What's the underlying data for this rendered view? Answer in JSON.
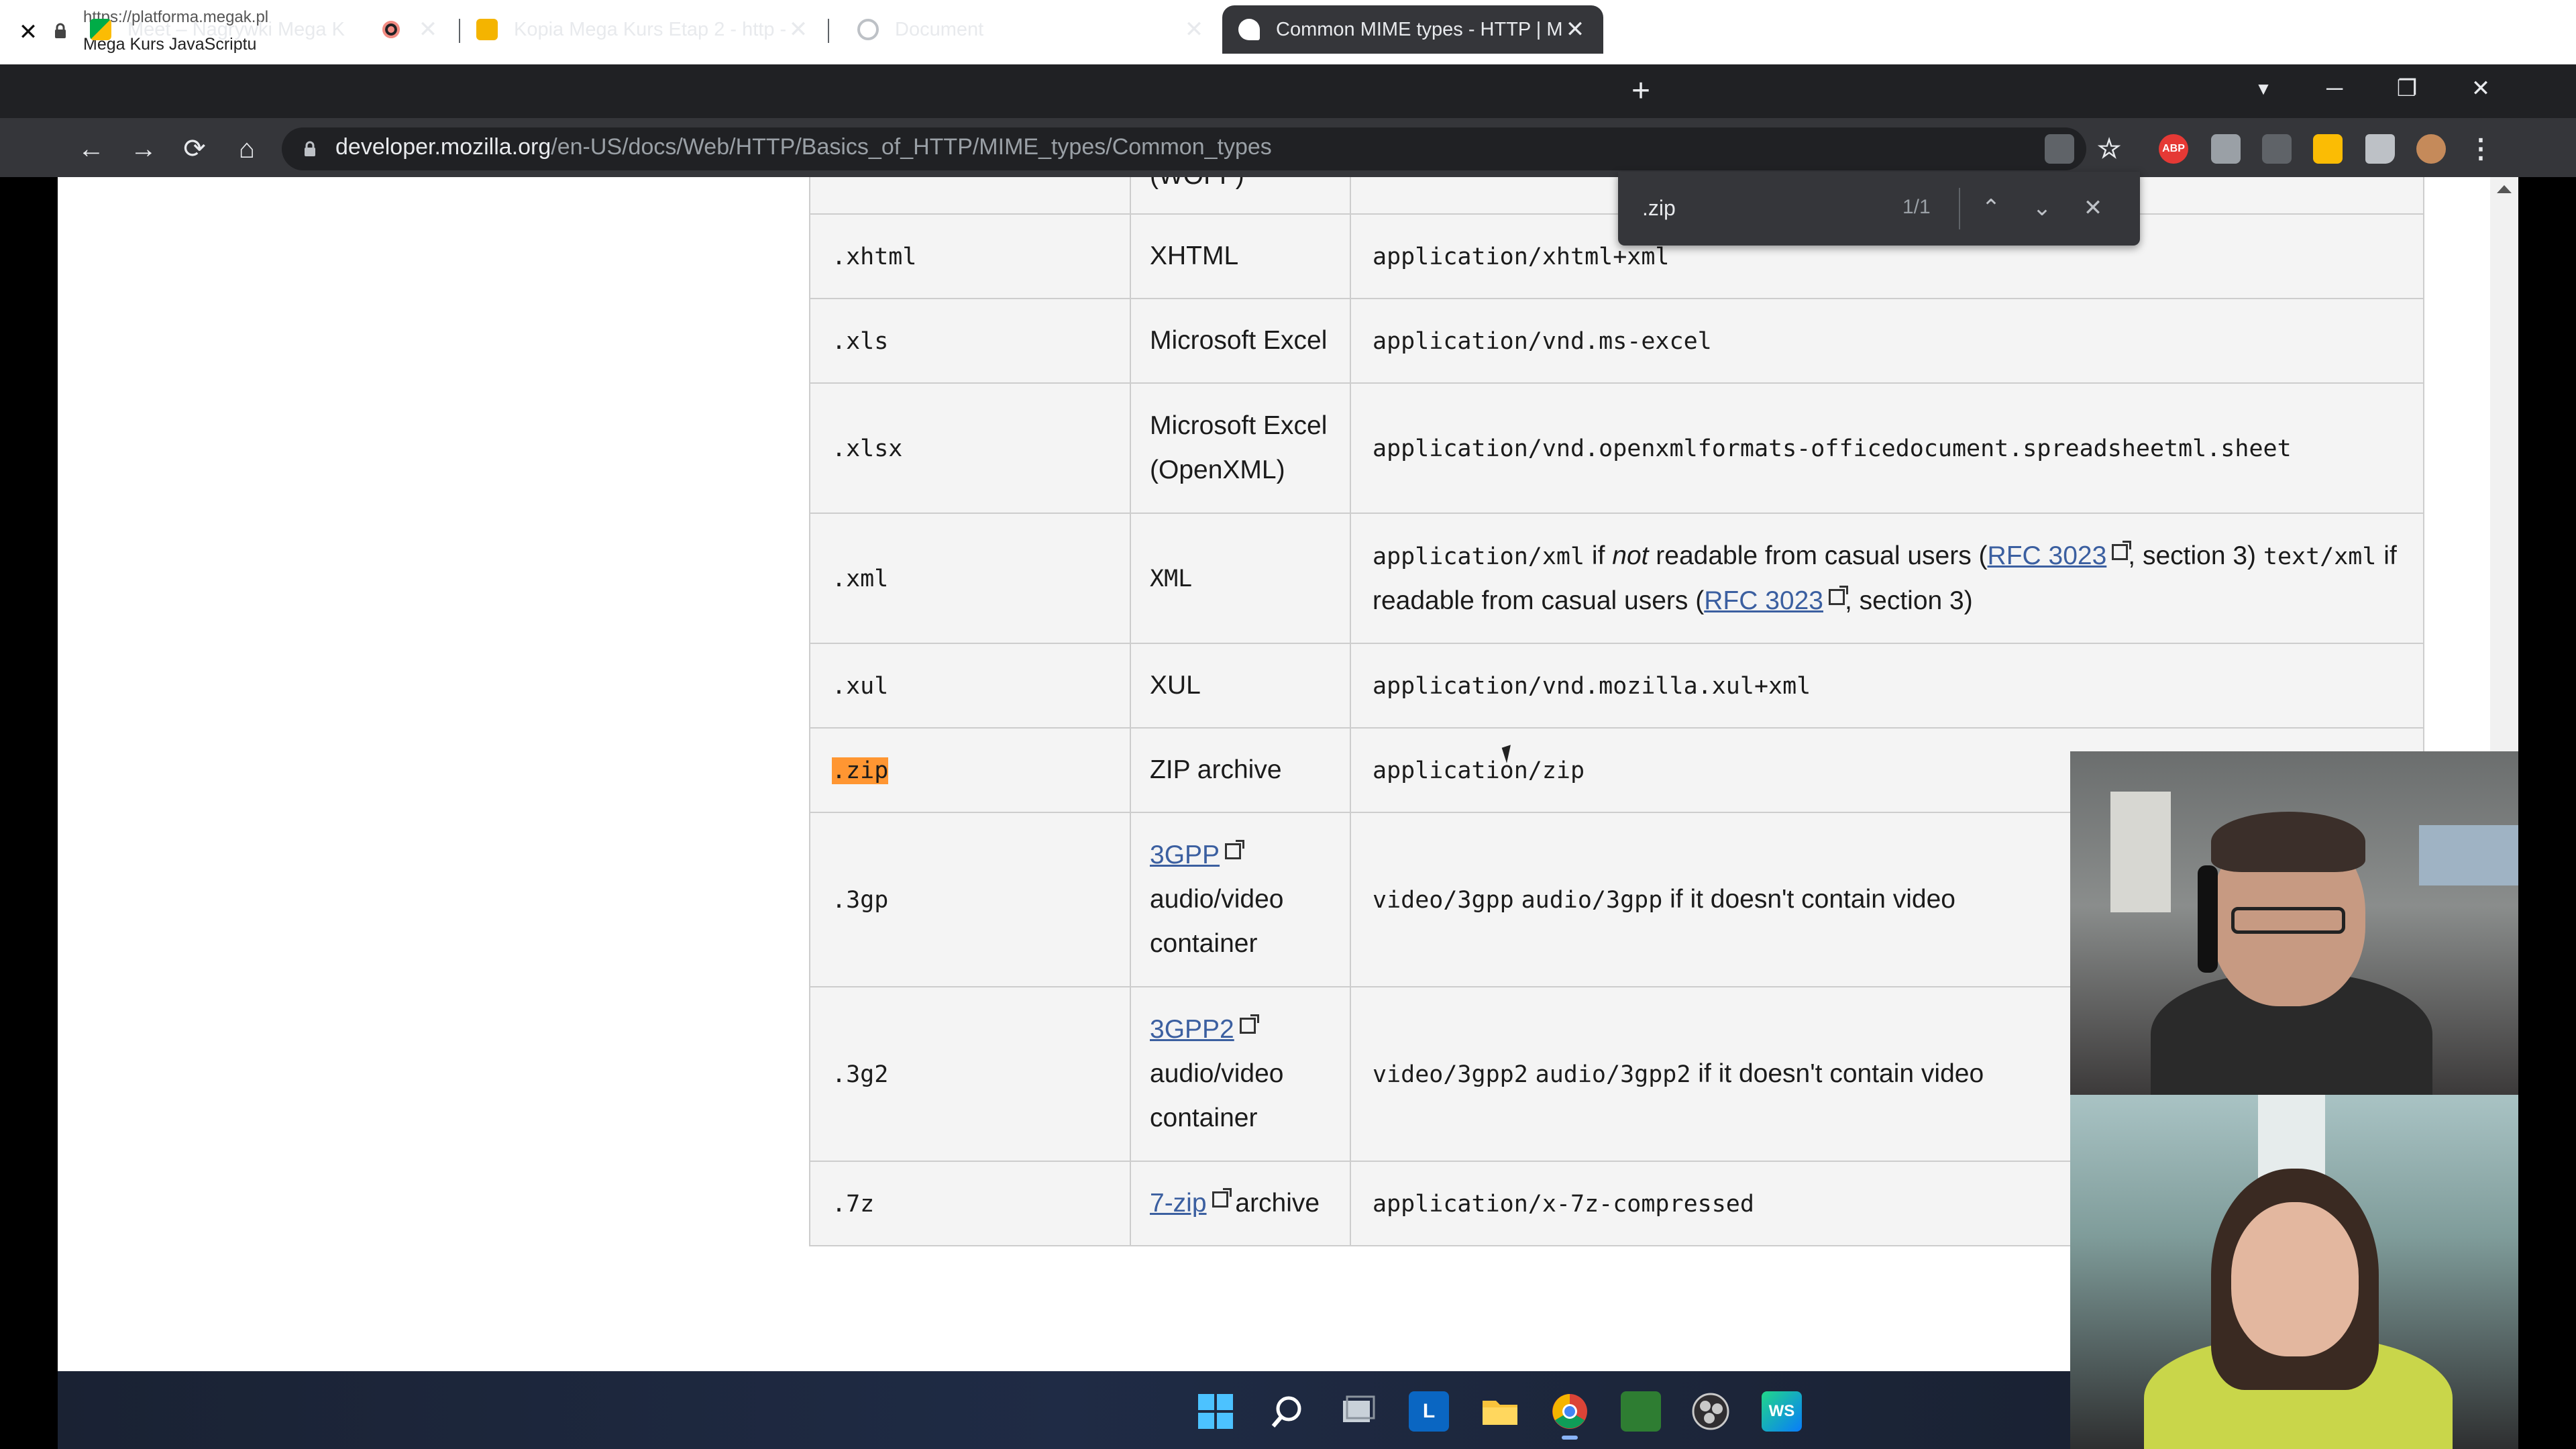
{
  "app_bar": {
    "url": "https://platforma.megak.pl",
    "title": "Mega Kurs JavaScriptu"
  },
  "tabs": [
    {
      "label": "Meet – Nagrywki Mega K",
      "icon": "google-meet-icon",
      "recording": true
    },
    {
      "label": "Kopia Mega Kurs Etap 2 - http - ",
      "icon": "slides-icon"
    },
    {
      "label": "Document",
      "icon": "globe-icon"
    },
    {
      "label": "Common MIME types - HTTP | M",
      "icon": "mdn-icon",
      "active": true
    }
  ],
  "address": {
    "host": "developer.mozilla.org",
    "path": "/en-US/docs/Web/HTTP/Basics_of_HTTP/MIME_types/Common_types"
  },
  "extensions": [
    "ABP",
    "ext-grey",
    "ext-glasses",
    "ext-yellow",
    "puzzle-icon"
  ],
  "find": {
    "query": ".zip",
    "count": "1/1"
  },
  "table": {
    "partial_top_type": "(WOFF)",
    "rows": [
      {
        "ext": ".xhtml",
        "type": "XHTML",
        "mime": "application/xhtml+xml"
      },
      {
        "ext": ".xls",
        "type": "Microsoft Excel",
        "mime": "application/vnd.ms-excel"
      },
      {
        "ext": ".xlsx",
        "type_line1": "Microsoft Excel",
        "type_line2": "(OpenXML)",
        "mime": "application/vnd.openxmlformats-officedocument.spreadsheetml.sheet"
      },
      {
        "ext": ".xml",
        "type": "XML",
        "mime_a": "application/xml",
        "text_if": " if ",
        "text_not": "not",
        "text_readable": " readable from casual users (",
        "rfc": "RFC 3023",
        "text_section": ", section 3) ",
        "mime_b": "text/xml",
        "text_if2": " if readable from casual users (",
        "text_section2": ", section 3)"
      },
      {
        "ext": ".xul",
        "type": "XUL",
        "mime": "application/vnd.mozilla.xul+xml"
      },
      {
        "ext": ".zip",
        "type": "ZIP archive",
        "mime": "application/zip",
        "highlighted": true
      },
      {
        "ext": ".3gp",
        "type_link": "3GPP",
        "type_line2": "audio/video",
        "type_line3": "container",
        "mime_a": "video/3gpp",
        "mime_b": "audio/3gpp",
        "note": " if it doesn't contain video"
      },
      {
        "ext": ".3g2",
        "type_link": "3GPP2",
        "type_line2": "audio/video",
        "type_line3": "container",
        "mime_a": "video/3gpp2",
        "mime_b": "audio/3gpp2",
        "note": " if it doesn't contain video"
      },
      {
        "ext": ".7z",
        "type_link": "7-zip",
        "type_rest": " archive",
        "mime": "application/x-7z-compressed"
      }
    ]
  },
  "taskbar_icons": [
    "windows-start-icon",
    "search-icon",
    "task-view-icon",
    "app-L-icon",
    "file-explorer-icon",
    "chrome-icon",
    "photos-icon",
    "obs-icon",
    "webstorm-icon"
  ],
  "taskbar_letters": {
    "l": "L",
    "ws": "WS"
  },
  "glyphs": {
    "close": "✕",
    "minimize": "─",
    "restore": "❐",
    "plus": "+",
    "back": "←",
    "forward": "→",
    "reload": "⟳",
    "home": "⌂",
    "star": "☆",
    "menu": "⋮",
    "up": "⌃",
    "down": "⌄",
    "chrome_profile": "▼"
  }
}
